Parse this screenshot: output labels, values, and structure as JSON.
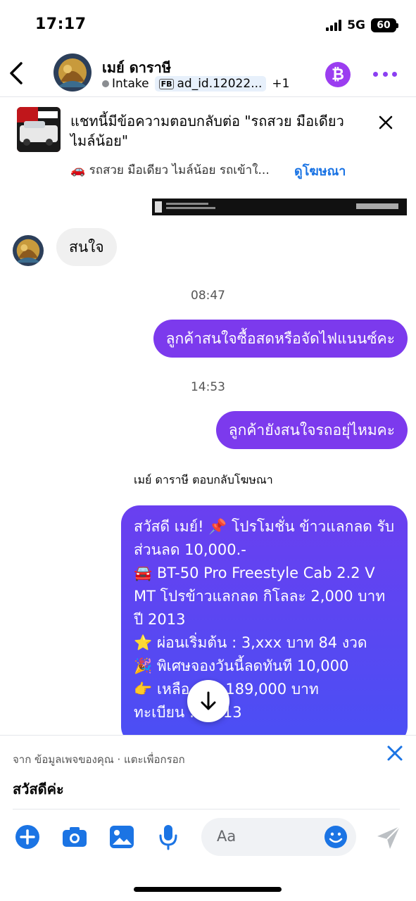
{
  "status": {
    "time": "17:17",
    "network": "5G",
    "battery": "60"
  },
  "header": {
    "name": "เมย์ ดาราษี",
    "status_tag": "Intake",
    "fb_badge": "FB",
    "ad_tag": "ad_id.12022...",
    "extra_tags": "+1",
    "coin_symbol": "₿"
  },
  "ad_banner": {
    "text": "แชทนี้มีข้อความตอบกลับต่อ \"รถสวย มือเดียว ไมล์น้อย\"",
    "subtitle": "🚗 รถสวย มือเดียว ไมล์น้อย รถเข้าใ...",
    "link": "ดูโฆษณา"
  },
  "messages": {
    "incoming_1": "สนใจ",
    "time_1": "08:47",
    "outgoing_1": "ลูกค้าสนใจซื้อสดหรือจัดไฟแนนซ์คะ",
    "time_2": "14:53",
    "outgoing_2": "ลูกค้ายังสนใจรถอยุ่ไหมคะ",
    "reply_label": "เมย์ ดาราษี ตอบกลับโฆษณา",
    "ad_reply_lines": [
      "สวัสดี เมย์! 📌 โปรโมชั่น ข้าวแลกลด รับส่วนลด 10,000.-",
      "🚘 BT-50 Pro Freestyle Cab 2.2 V MT โปรข้าวแลกลด กิโลละ 2,000 บาท ปี 2013",
      "⭐ ผ่อนเริ่มต้น : 3,xxx บาท 84 งวด",
      "🎉 พิเศษจองวันนี้ลดทันที 10,000",
      "👉 เหลือ ดง : 189,000 บาท",
      "ทะเบียน : W013"
    ]
  },
  "suggestion": {
    "source": "จาก ข้อมูลเพจของคุณ · แตะเพื่อกรอก",
    "text": "สวัสดีค่ะ"
  },
  "composer": {
    "placeholder": "Aa"
  },
  "colors": {
    "accent": "#7c3aed",
    "link": "#1b74e4",
    "icon_blue": "#1b74e4"
  }
}
